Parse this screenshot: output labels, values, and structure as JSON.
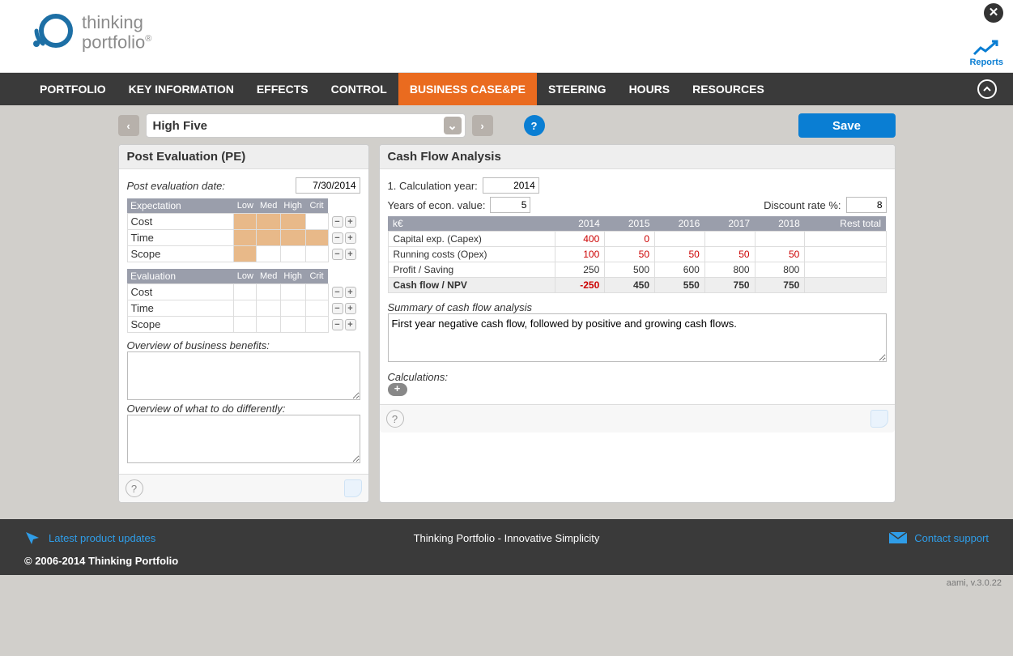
{
  "brand": {
    "line1": "thinking",
    "line2": "portfolio"
  },
  "header": {
    "reports": "Reports"
  },
  "nav": {
    "items": [
      "PORTFOLIO",
      "KEY INFORMATION",
      "EFFECTS",
      "CONTROL",
      "BUSINESS CASE&PE",
      "STEERING",
      "HOURS",
      "RESOURCES"
    ],
    "active_index": 4
  },
  "toolbar": {
    "project_title": "High Five",
    "save_label": "Save"
  },
  "pe_panel": {
    "title": "Post Evaluation (PE)",
    "date_label": "Post evaluation date:",
    "date_value": "7/30/2014",
    "expectation_header": "Expectation",
    "evaluation_header": "Evaluation",
    "col_labels": [
      "Low",
      "Med",
      "High",
      "Crit"
    ],
    "exp_rows": [
      {
        "label": "Cost",
        "fill": [
          true,
          true,
          true,
          false
        ]
      },
      {
        "label": "Time",
        "fill": [
          true,
          true,
          true,
          true
        ]
      },
      {
        "label": "Scope",
        "fill": [
          true,
          false,
          false,
          false
        ]
      }
    ],
    "eval_rows": [
      {
        "label": "Cost"
      },
      {
        "label": "Time"
      },
      {
        "label": "Scope"
      }
    ],
    "benefits_label": "Overview of business benefits:",
    "benefits_value": "",
    "diff_label": "Overview of what to do differently:",
    "diff_value": ""
  },
  "cf_panel": {
    "title": "Cash Flow Analysis",
    "calc_year_label": "1. Calculation year:",
    "calc_year_value": "2014",
    "econ_label": "Years of econ. value:",
    "econ_value": "5",
    "discount_label": "Discount rate %:",
    "discount_value": "8",
    "unit_header": "k€",
    "year_headers": [
      "2014",
      "2015",
      "2016",
      "2017",
      "2018",
      "Rest total"
    ],
    "rows": [
      {
        "label": "Capital exp. (Capex)",
        "vals": [
          "400",
          "0",
          "",
          "",
          "",
          ""
        ],
        "neg": [
          true,
          true,
          false,
          false,
          false,
          false
        ]
      },
      {
        "label": "Running costs (Opex)",
        "vals": [
          "100",
          "50",
          "50",
          "50",
          "50",
          ""
        ],
        "neg": [
          true,
          true,
          true,
          true,
          true,
          false
        ]
      },
      {
        "label": "Profit / Saving",
        "vals": [
          "250",
          "500",
          "600",
          "800",
          "800",
          ""
        ],
        "neg": [
          false,
          false,
          false,
          false,
          false,
          false
        ]
      }
    ],
    "npv_row": {
      "label": "Cash flow / NPV",
      "vals": [
        "-250",
        "450",
        "550",
        "750",
        "750",
        ""
      ],
      "neg": [
        true,
        false,
        false,
        false,
        false,
        false
      ]
    },
    "summary_label": "Summary of cash flow analysis",
    "summary_value": "First year negative cash flow, followed by positive and growing cash flows.",
    "calculations_label": "Calculations:"
  },
  "footer": {
    "updates": "Latest product updates",
    "tagline": "Thinking Portfolio - Innovative Simplicity",
    "contact": "Contact support",
    "copyright": "© 2006-2014 Thinking Portfolio",
    "version": "aami, v.3.0.22"
  },
  "chart_data": {
    "type": "table",
    "title": "Cash Flow Analysis",
    "unit": "k€",
    "columns": [
      "2014",
      "2015",
      "2016",
      "2017",
      "2018",
      "Rest total"
    ],
    "series": [
      {
        "name": "Capital exp. (Capex)",
        "values": [
          400,
          0,
          null,
          null,
          null,
          null
        ]
      },
      {
        "name": "Running costs (Opex)",
        "values": [
          100,
          50,
          50,
          50,
          50,
          null
        ]
      },
      {
        "name": "Profit / Saving",
        "values": [
          250,
          500,
          600,
          800,
          800,
          null
        ]
      },
      {
        "name": "Cash flow / NPV",
        "values": [
          -250,
          450,
          550,
          750,
          750,
          null
        ]
      }
    ],
    "parameters": {
      "calculation_year": 2014,
      "years_of_econ_value": 5,
      "discount_rate_pct": 8
    }
  }
}
